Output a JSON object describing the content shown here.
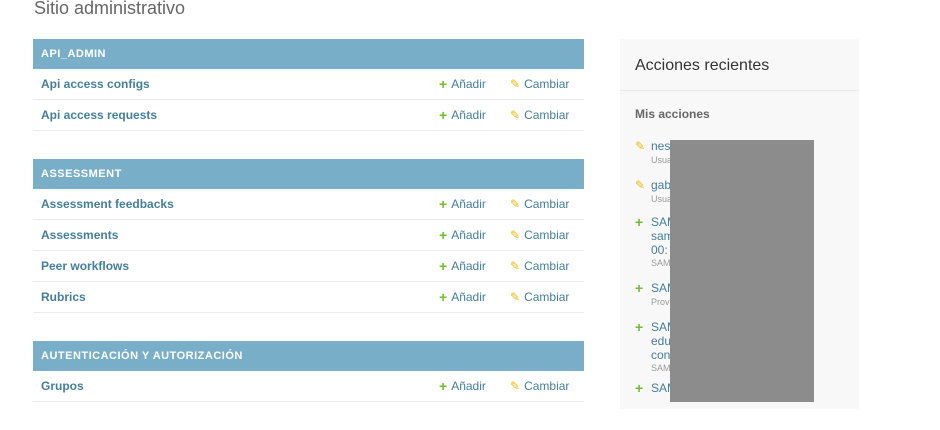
{
  "page": {
    "title": "Sitio administrativo"
  },
  "actions": {
    "add_label": "Añadir",
    "change_label": "Cambiar"
  },
  "modules": [
    {
      "header": "API_ADMIN",
      "models": [
        "Api access configs",
        "Api access requests"
      ]
    },
    {
      "header": "ASSESSMENT",
      "models": [
        "Assessment feedbacks",
        "Assessments",
        "Peer workflows",
        "Rubrics"
      ]
    },
    {
      "header": "AUTENTICACIÓN Y AUTORIZACIÓN",
      "models": [
        "Grupos"
      ]
    }
  ],
  "recent": {
    "title": "Acciones recientes",
    "mine_title": "Mis acciones",
    "entries": [
      {
        "icon": "pencil-icon",
        "text": "nes",
        "sub": "Usua"
      },
      {
        "icon": "pencil-icon",
        "text": "gab",
        "sub": "Usua"
      },
      {
        "icon": "plus-icon",
        "text": "SAM                              om:\nsam\n00:",
        "sub": "SAM"
      },
      {
        "icon": "plus-icon",
        "text": "SAM",
        "sub": "Prov"
      },
      {
        "icon": "plus-icon",
        "text": "SAM\nedu                              aml-\ncon                                 0",
        "sub": "SAM"
      },
      {
        "icon": "plus-icon",
        "text": "SAM",
        "sub": ""
      }
    ]
  },
  "colors": {
    "header": "#79aec8",
    "link": "#447e9b",
    "add": "#70bf2b",
    "change": "#efb80b",
    "redaction": "#8c8c8c"
  }
}
